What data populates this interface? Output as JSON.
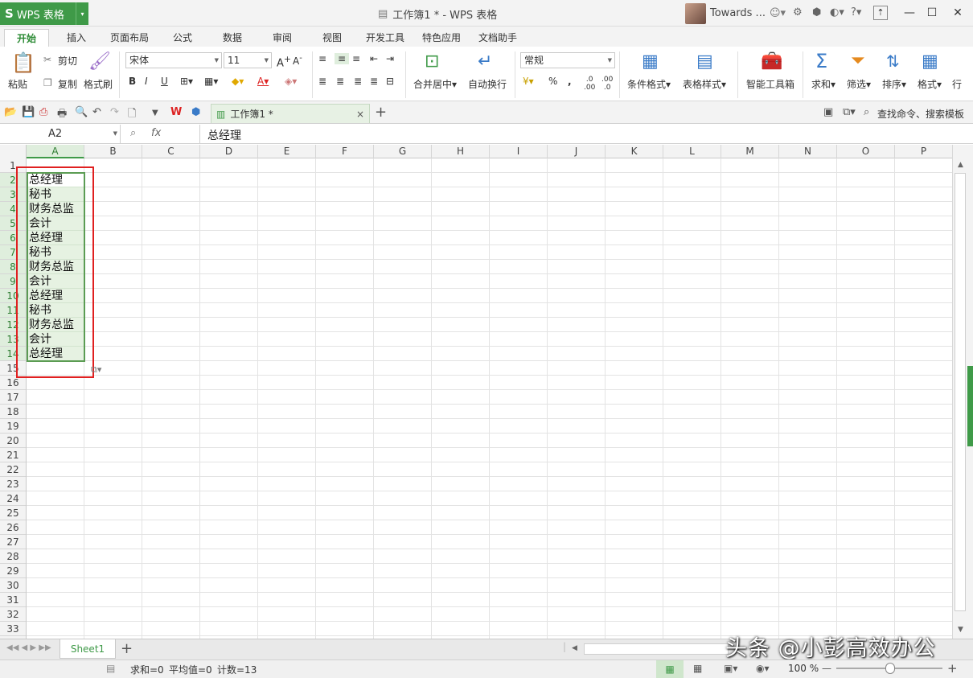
{
  "app": {
    "logo": "S",
    "name": "WPS 表格",
    "dropdown": "▾"
  },
  "window": {
    "title": "工作簿1 * - WPS 表格",
    "user": "Towards ...",
    "minimize": "—",
    "maximize": "☐",
    "close": "✕",
    "help": "?"
  },
  "tabs": [
    "开始",
    "插入",
    "页面布局",
    "公式",
    "数据",
    "审阅",
    "视图",
    "开发工具",
    "特色应用",
    "文档助手"
  ],
  "ribbon": {
    "paste": "粘贴",
    "cut": "剪切",
    "copy": "复制",
    "format_painter": "格式刷",
    "font_name": "宋体",
    "font_size": "11",
    "bold": "B",
    "italic": "I",
    "underline": "U",
    "merge_center": "合并居中",
    "wrap_text": "自动换行",
    "number_format": "常规",
    "percent": "%",
    "comma": ",",
    "cond_format": "条件格式",
    "table_style": "表格样式",
    "smart_toolbox": "智能工具箱",
    "sum": "求和",
    "filter": "筛选",
    "sort": "排序",
    "format": "格式",
    "row_col": "行"
  },
  "doc_tab": {
    "name": "工作簿1 *",
    "close": "×",
    "add": "+"
  },
  "search": {
    "label": "查找命令、搜索模板"
  },
  "formula_bar": {
    "name_box": "A2",
    "fx": "fx",
    "content": "总经理"
  },
  "columns": [
    "A",
    "B",
    "C",
    "D",
    "E",
    "F",
    "G",
    "H",
    "I",
    "J",
    "K",
    "L",
    "M",
    "N",
    "O",
    "P"
  ],
  "rows": [
    "1",
    "2",
    "3",
    "4",
    "5",
    "6",
    "7",
    "8",
    "9",
    "10",
    "11",
    "12",
    "13",
    "14",
    "15",
    "16",
    "17",
    "18",
    "19",
    "20",
    "21",
    "22",
    "23",
    "24",
    "25",
    "26",
    "27",
    "28",
    "29",
    "30",
    "31",
    "32",
    "33"
  ],
  "cells_a": [
    "总经理",
    "秘书",
    "财务总监",
    "会计",
    "总经理",
    "秘书",
    "财务总监",
    "会计",
    "总经理",
    "秘书",
    "财务总监",
    "会计",
    "总经理"
  ],
  "sheet": {
    "name": "Sheet1",
    "add": "+"
  },
  "status": {
    "sum": "求和=0",
    "average": "平均值=0",
    "count": "计数=13",
    "zoom": "100 %",
    "zoom_minus": "—",
    "zoom_plus": "+"
  },
  "watermark": "头条 @小彭高效办公",
  "colors": {
    "accent": "#3f9a48",
    "highlight": "#e02020",
    "selection_fill": "#e6f2e2"
  }
}
